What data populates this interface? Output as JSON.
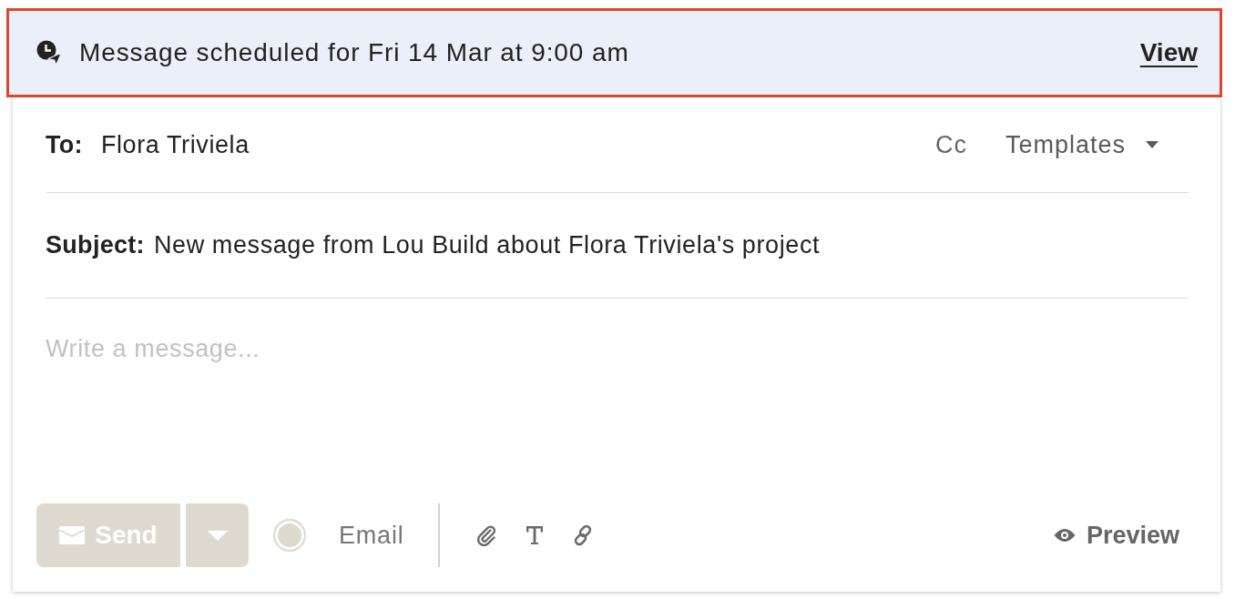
{
  "banner": {
    "message": "Message scheduled for Fri 14 Mar at 9:00 am",
    "action": "View"
  },
  "to": {
    "label": "To:",
    "value": "Flora Triviela"
  },
  "header_actions": {
    "cc": "Cc",
    "templates": "Templates"
  },
  "subject": {
    "label": "Subject:",
    "value": "New message from Lou Build about Flora Triviela's project"
  },
  "message": {
    "placeholder": "Write a message..."
  },
  "toolbar": {
    "send": {
      "label": "Send",
      "disabled": true
    },
    "channel": {
      "label": "Email",
      "selected": true
    },
    "preview": "Preview"
  }
}
